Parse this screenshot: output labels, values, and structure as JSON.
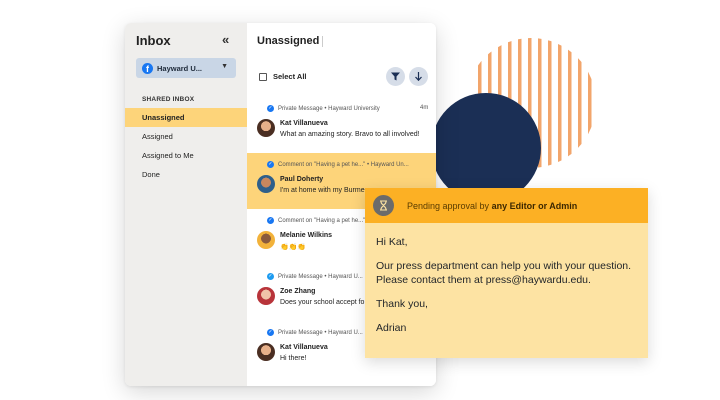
{
  "sidebar": {
    "title": "Inbox",
    "account": "Hayward U...",
    "section_label": "SHARED INBOX",
    "items": [
      {
        "label": "Unassigned",
        "active": true
      },
      {
        "label": "Assigned",
        "active": false
      },
      {
        "label": "Assigned to Me",
        "active": false
      },
      {
        "label": "Done",
        "active": false
      }
    ]
  },
  "main": {
    "title": "Unassigned",
    "select_all": "Select All",
    "messages": [
      {
        "channel": "Private Message • Hayward University",
        "time": "4m",
        "name": "Kat Villanueva",
        "text": "What an amazing story. Bravo to all involved!",
        "icon": "facebook-messenger-icon"
      },
      {
        "channel": "Comment on \"Having a pet he...\" • Hayward Un...",
        "time": "",
        "name": "Paul Doherty",
        "text": "I'm at home with my Burme",
        "icon": "facebook-messenger-icon"
      },
      {
        "channel": "Comment on \"Having a pet he...\" • Hayward Un...",
        "time": "",
        "name": "Melanie Wilkins",
        "text": "👏👏👏",
        "icon": "facebook-messenger-icon"
      },
      {
        "channel": "Private Message • Hayward U...",
        "time": "",
        "name": "Zoe Zhang",
        "text": "Does your school accept fo",
        "icon": "twitter-icon"
      },
      {
        "channel": "Private Message • Hayward U...",
        "time": "",
        "name": "Kat Villanueva",
        "text": "Hi there!",
        "icon": "facebook-messenger-icon"
      }
    ]
  },
  "approval": {
    "header_prefix": "Pending approval by ",
    "header_bold": "any Editor or Admin",
    "greeting": "Hi Kat,",
    "body": "Our press department can help you with your question. Please contact them at press@haywardu.edu.",
    "closing": "Thank you,",
    "signature": "Adrian"
  },
  "colors": {
    "accent_yellow": "#fdd47a",
    "header_orange": "#fcb024",
    "navy": "#1b2f55",
    "stripe_orange": "#f2a56b"
  }
}
